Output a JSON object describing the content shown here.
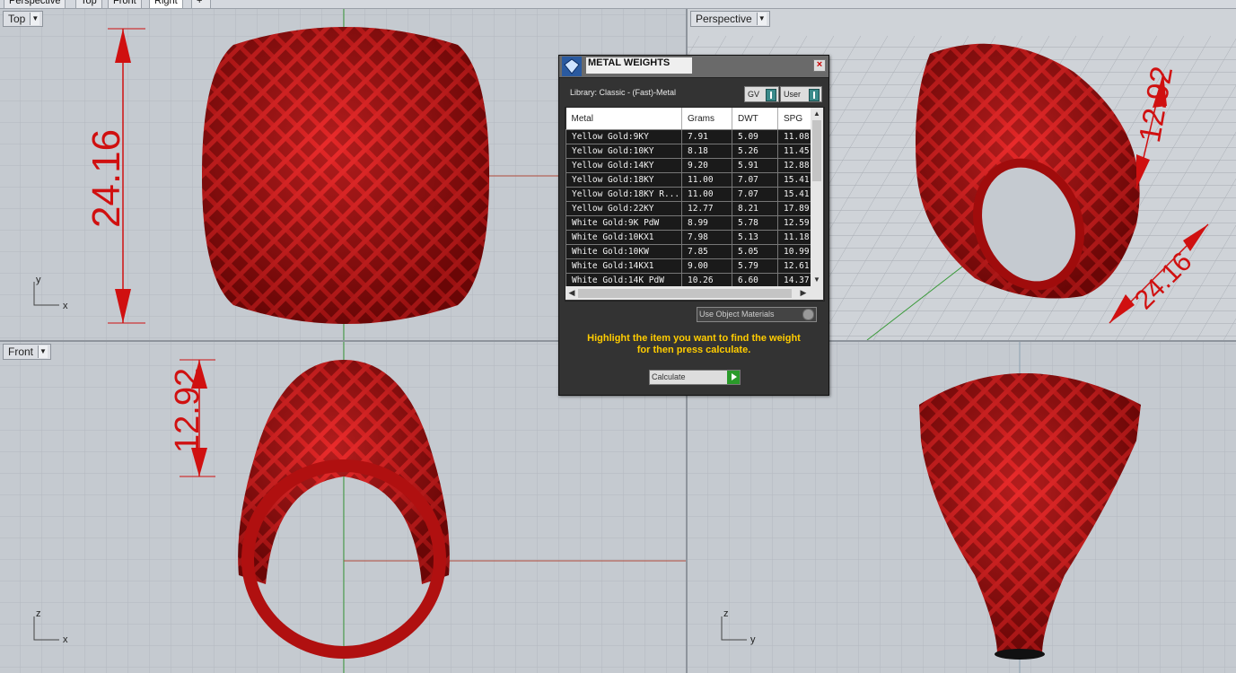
{
  "tabs": [
    "Perspective",
    "Top",
    "Front",
    "Right"
  ],
  "active_tab": "Right",
  "viewports": {
    "top": {
      "label": "Top",
      "dimension": "24.16",
      "axis_v": "y",
      "axis_h": "x"
    },
    "perspective": {
      "label": "Perspective",
      "dim_a": "12.92",
      "dim_b": "24.16"
    },
    "front": {
      "label": "Front",
      "dimension": "12.92",
      "axis_v": "z",
      "axis_h": "x"
    },
    "right": {
      "axis_v": "z",
      "axis_h": "y"
    }
  },
  "panel": {
    "title": "METAL WEIGHTS",
    "library": "Library: Classic - (Fast)-Metal",
    "toggle_gv": "GV",
    "toggle_user": "User",
    "columns": [
      "Metal",
      "Grams",
      "DWT",
      "SPG"
    ],
    "rows": [
      [
        "Yellow Gold:9KY",
        "7.91",
        "5.09",
        "11.08"
      ],
      [
        "Yellow Gold:10KY",
        "8.18",
        "5.26",
        "11.45"
      ],
      [
        "Yellow Gold:14KY",
        "9.20",
        "5.91",
        "12.88"
      ],
      [
        "Yellow Gold:18KY",
        "11.00",
        "7.07",
        "15.41"
      ],
      [
        "Yellow Gold:18KY R...",
        "11.00",
        "7.07",
        "15.41"
      ],
      [
        "Yellow Gold:22KY",
        "12.77",
        "8.21",
        "17.89"
      ],
      [
        "White Gold:9K PdW",
        "8.99",
        "5.78",
        "12.59"
      ],
      [
        "White Gold:10KX1",
        "7.98",
        "5.13",
        "11.18"
      ],
      [
        "White Gold:10KW",
        "7.85",
        "5.05",
        "10.99"
      ],
      [
        "White Gold:14KX1",
        "9.00",
        "5.79",
        "12.61"
      ],
      [
        "White Gold:14K PdW",
        "10.26",
        "6.60",
        "14.37"
      ]
    ],
    "use_object_materials": "Use Object Materials",
    "hint_line1": "Highlight the item you want to find the weight",
    "hint_line2": "for then press calculate.",
    "calculate": "Calculate"
  },
  "colors": {
    "ring": "#c81414",
    "dimension": "#d01010",
    "panel_hint": "#ffcc00",
    "viewport_bg": "#c5cad0"
  }
}
